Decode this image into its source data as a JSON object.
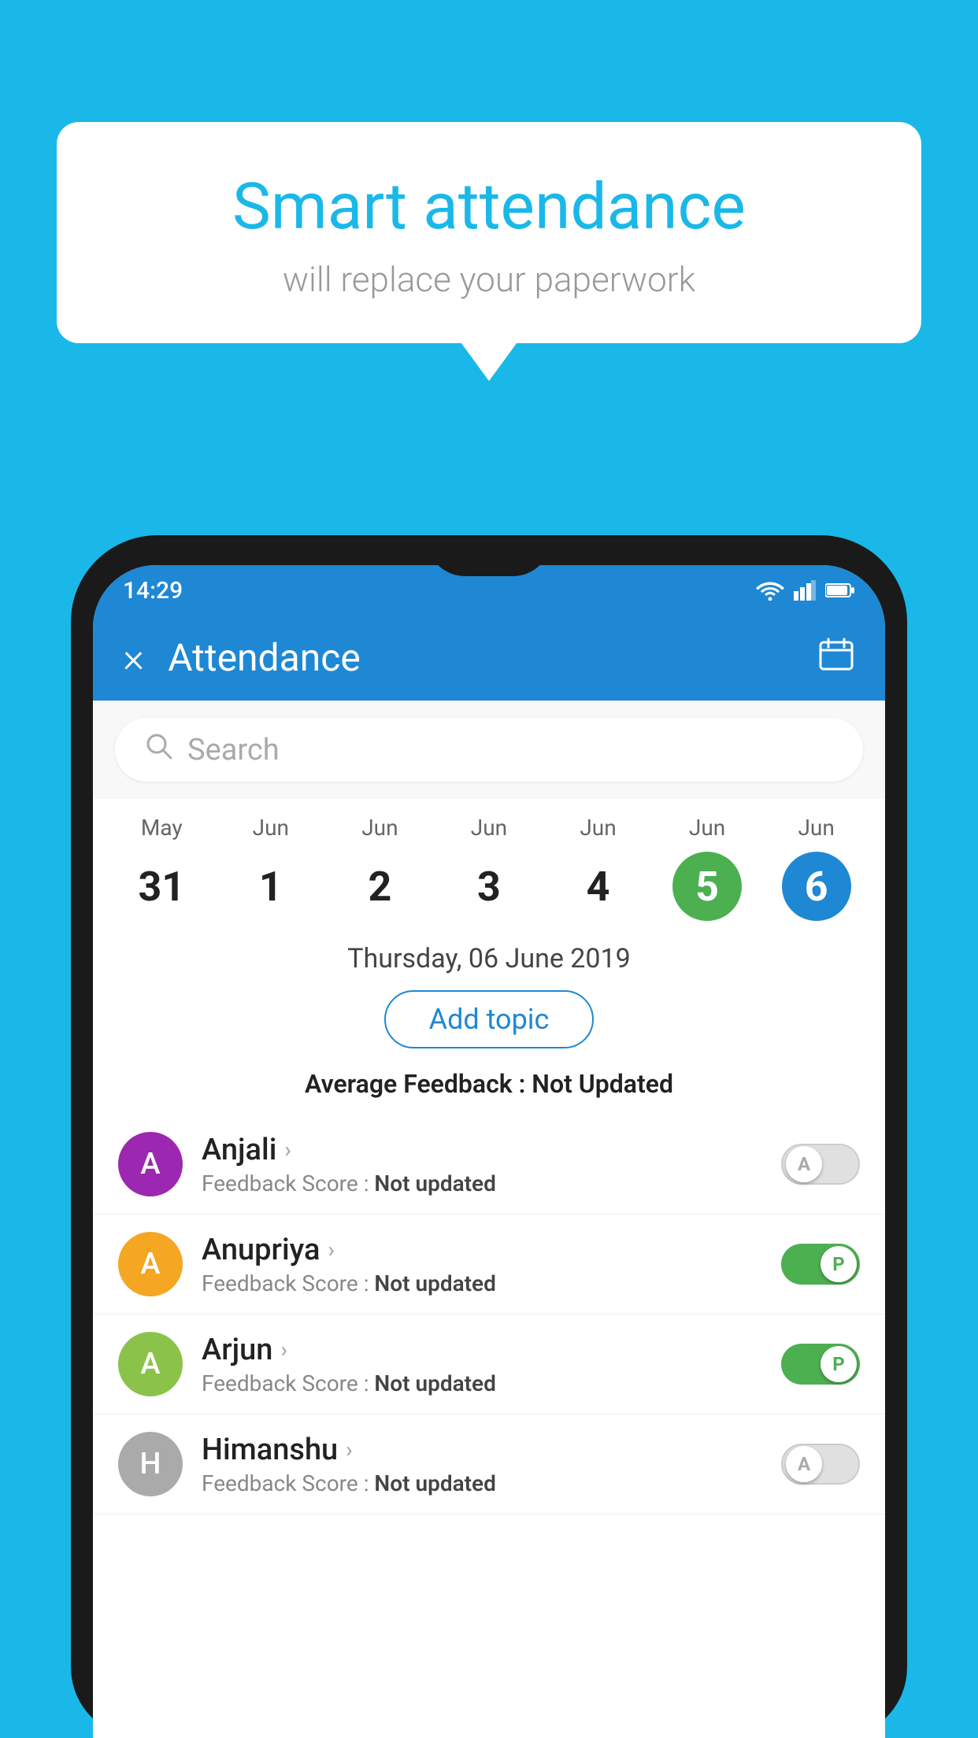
{
  "background": {
    "color": "#1ab8e8"
  },
  "hero": {
    "title": "Smart attendance",
    "subtitle": "will replace your paperwork"
  },
  "statusBar": {
    "time": "14:29",
    "icons": [
      "wifi",
      "signal",
      "battery"
    ]
  },
  "appBar": {
    "title": "Attendance",
    "closeLabel": "×",
    "calendarLabel": "📅"
  },
  "search": {
    "placeholder": "Search"
  },
  "calendar": {
    "dates": [
      {
        "month": "May",
        "day": "31",
        "style": "normal"
      },
      {
        "month": "Jun",
        "day": "1",
        "style": "normal"
      },
      {
        "month": "Jun",
        "day": "2",
        "style": "normal"
      },
      {
        "month": "Jun",
        "day": "3",
        "style": "normal"
      },
      {
        "month": "Jun",
        "day": "4",
        "style": "normal"
      },
      {
        "month": "Jun",
        "day": "5",
        "style": "green"
      },
      {
        "month": "Jun",
        "day": "6",
        "style": "blue"
      }
    ]
  },
  "selectedDate": {
    "label": "Thursday, 06 June 2019"
  },
  "addTopic": {
    "label": "Add topic"
  },
  "feedback": {
    "label": "Average Feedback :",
    "value": "Not Updated"
  },
  "students": [
    {
      "name": "Anjali",
      "avatarLetter": "A",
      "avatarColor": "#9c27b0",
      "feedbackLabel": "Feedback Score :",
      "feedbackValue": "Not updated",
      "toggleState": "off",
      "toggleLabel": "A"
    },
    {
      "name": "Anupriya",
      "avatarLetter": "A",
      "avatarColor": "#f5a623",
      "feedbackLabel": "Feedback Score :",
      "feedbackValue": "Not updated",
      "toggleState": "on",
      "toggleLabel": "P"
    },
    {
      "name": "Arjun",
      "avatarLetter": "A",
      "avatarColor": "#8bc34a",
      "feedbackLabel": "Feedback Score :",
      "feedbackValue": "Not updated",
      "toggleState": "on",
      "toggleLabel": "P"
    },
    {
      "name": "Himanshu",
      "avatarLetter": "H",
      "avatarColor": "#aaa",
      "feedbackLabel": "Feedback Score :",
      "feedbackValue": "Not updated",
      "toggleState": "off",
      "toggleLabel": "A"
    }
  ]
}
